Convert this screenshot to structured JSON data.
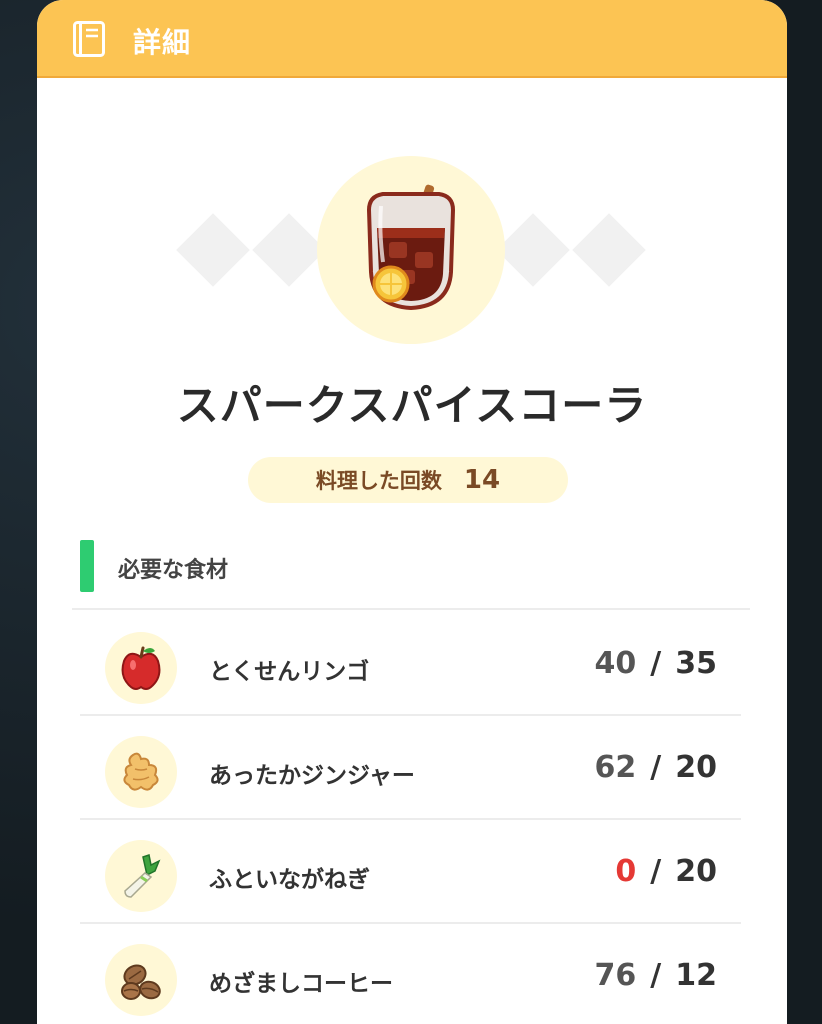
{
  "header": {
    "title": "詳細",
    "icon": "book-icon"
  },
  "dish": {
    "name": "スパークスパイスコーラ",
    "icon": "spiced-cola-glass-icon",
    "times_cooked_label": "料理した回数",
    "times_cooked_value": "14"
  },
  "ingredients_section": {
    "title": "必要な食材",
    "accent_color": "#2ecc71",
    "items": [
      {
        "name": "とくせんリンゴ",
        "icon": "apple-icon",
        "have": "40",
        "separator": "/",
        "need": "35"
      },
      {
        "name": "あったかジンジャー",
        "icon": "ginger-icon",
        "have": "62",
        "separator": "/",
        "need": "20"
      },
      {
        "name": "ふといながねぎ",
        "icon": "leek-icon",
        "have": "0",
        "separator": "/",
        "need": "20"
      },
      {
        "name": "めざましコーヒー",
        "icon": "coffee-beans-icon",
        "have": "76",
        "separator": "/",
        "need": "12"
      }
    ]
  },
  "colors": {
    "header": "#fcc453",
    "pill_background": "#fff8d6",
    "pill_text": "#7a4a25",
    "shortage": "#e53935"
  }
}
